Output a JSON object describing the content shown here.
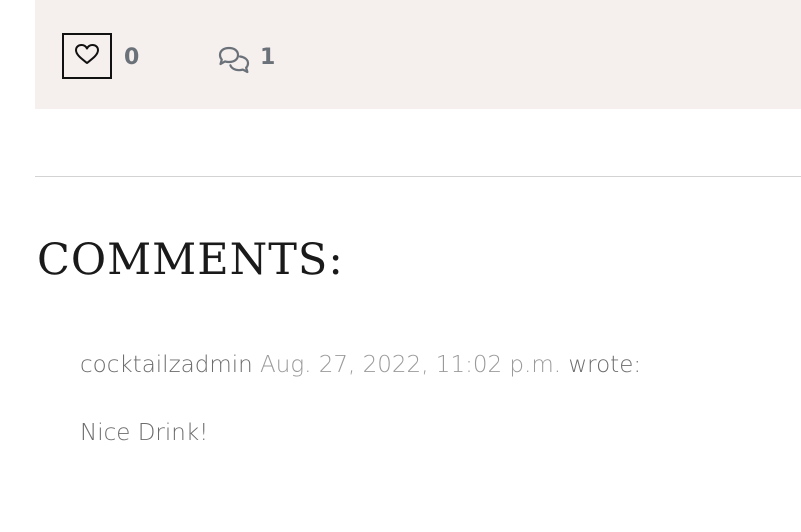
{
  "stats": {
    "like_icon": "heart-outline-icon",
    "like_count": "0",
    "comment_icon": "comments-icon",
    "comment_count": "1"
  },
  "comments_section": {
    "heading": "COMMENTS:",
    "comments": [
      {
        "author": "cocktailzadmin",
        "date": "Aug. 27, 2022, 11:02 p.m.",
        "suffix": "wrote:",
        "body": "Nice Drink!"
      }
    ]
  },
  "colors": {
    "stats_background": "#f5efee",
    "count_text": "#6b7178",
    "heading_text": "#1a1a1a",
    "comment_text": "#6c6c6c",
    "date_text": "#9a9a9a",
    "divider": "#d3d3d3"
  }
}
